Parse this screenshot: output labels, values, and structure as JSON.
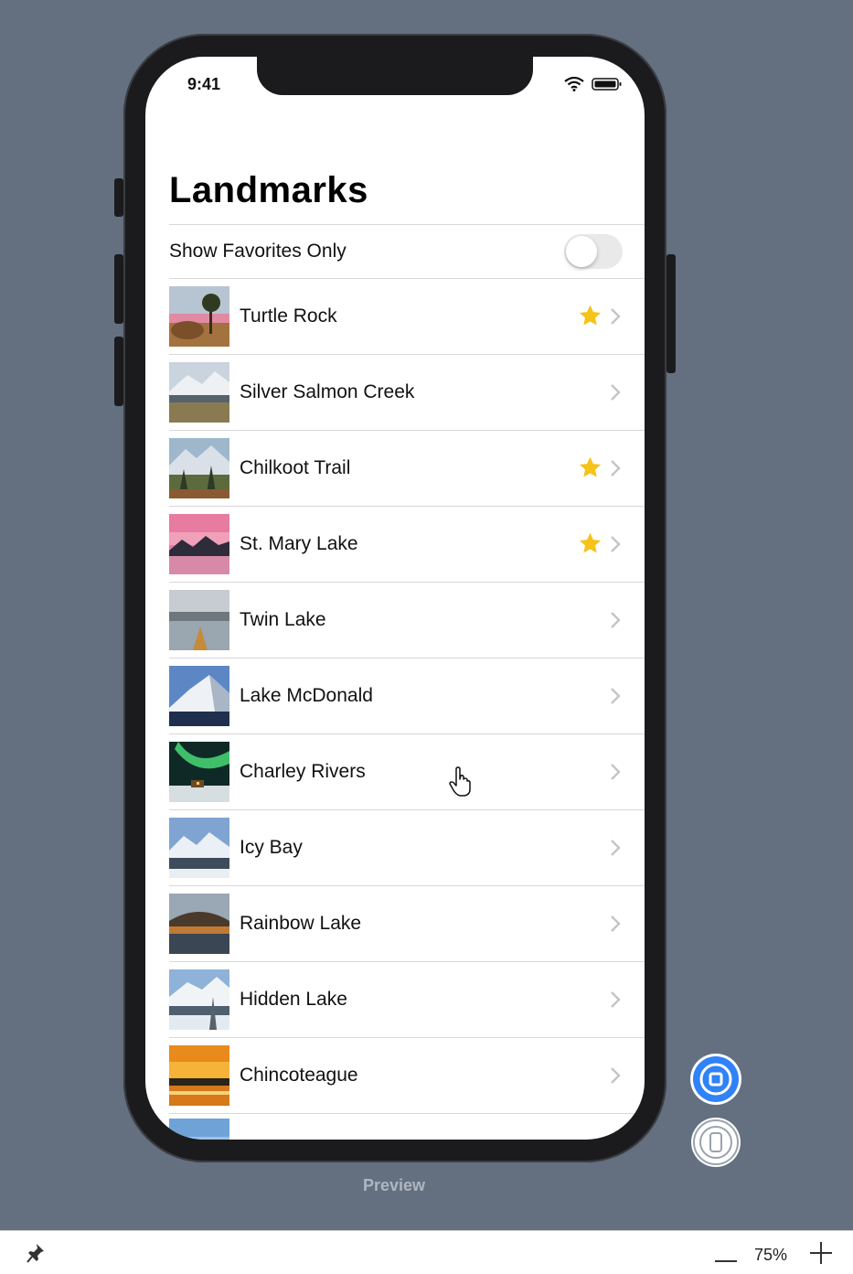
{
  "status_bar": {
    "time": "9:41"
  },
  "nav": {
    "title": "Landmarks"
  },
  "favorites_toggle": {
    "label": "Show Favorites Only",
    "is_on": false
  },
  "landmarks": [
    {
      "name": "Turtle Rock",
      "favorite": true
    },
    {
      "name": "Silver Salmon Creek",
      "favorite": false
    },
    {
      "name": "Chilkoot Trail",
      "favorite": true
    },
    {
      "name": "St. Mary Lake",
      "favorite": true
    },
    {
      "name": "Twin Lake",
      "favorite": false
    },
    {
      "name": "Lake McDonald",
      "favorite": false
    },
    {
      "name": "Charley Rivers",
      "favorite": false
    },
    {
      "name": "Icy Bay",
      "favorite": false
    },
    {
      "name": "Rainbow Lake",
      "favorite": false
    },
    {
      "name": "Hidden Lake",
      "favorite": false
    },
    {
      "name": "Chincoteague",
      "favorite": false
    }
  ],
  "preview": {
    "label": "Preview"
  },
  "toolbar": {
    "zoom_level": "75%"
  },
  "colors": {
    "star": "#f5c31a",
    "canvas": "#647080",
    "preview_accent": "#2f82f7"
  }
}
